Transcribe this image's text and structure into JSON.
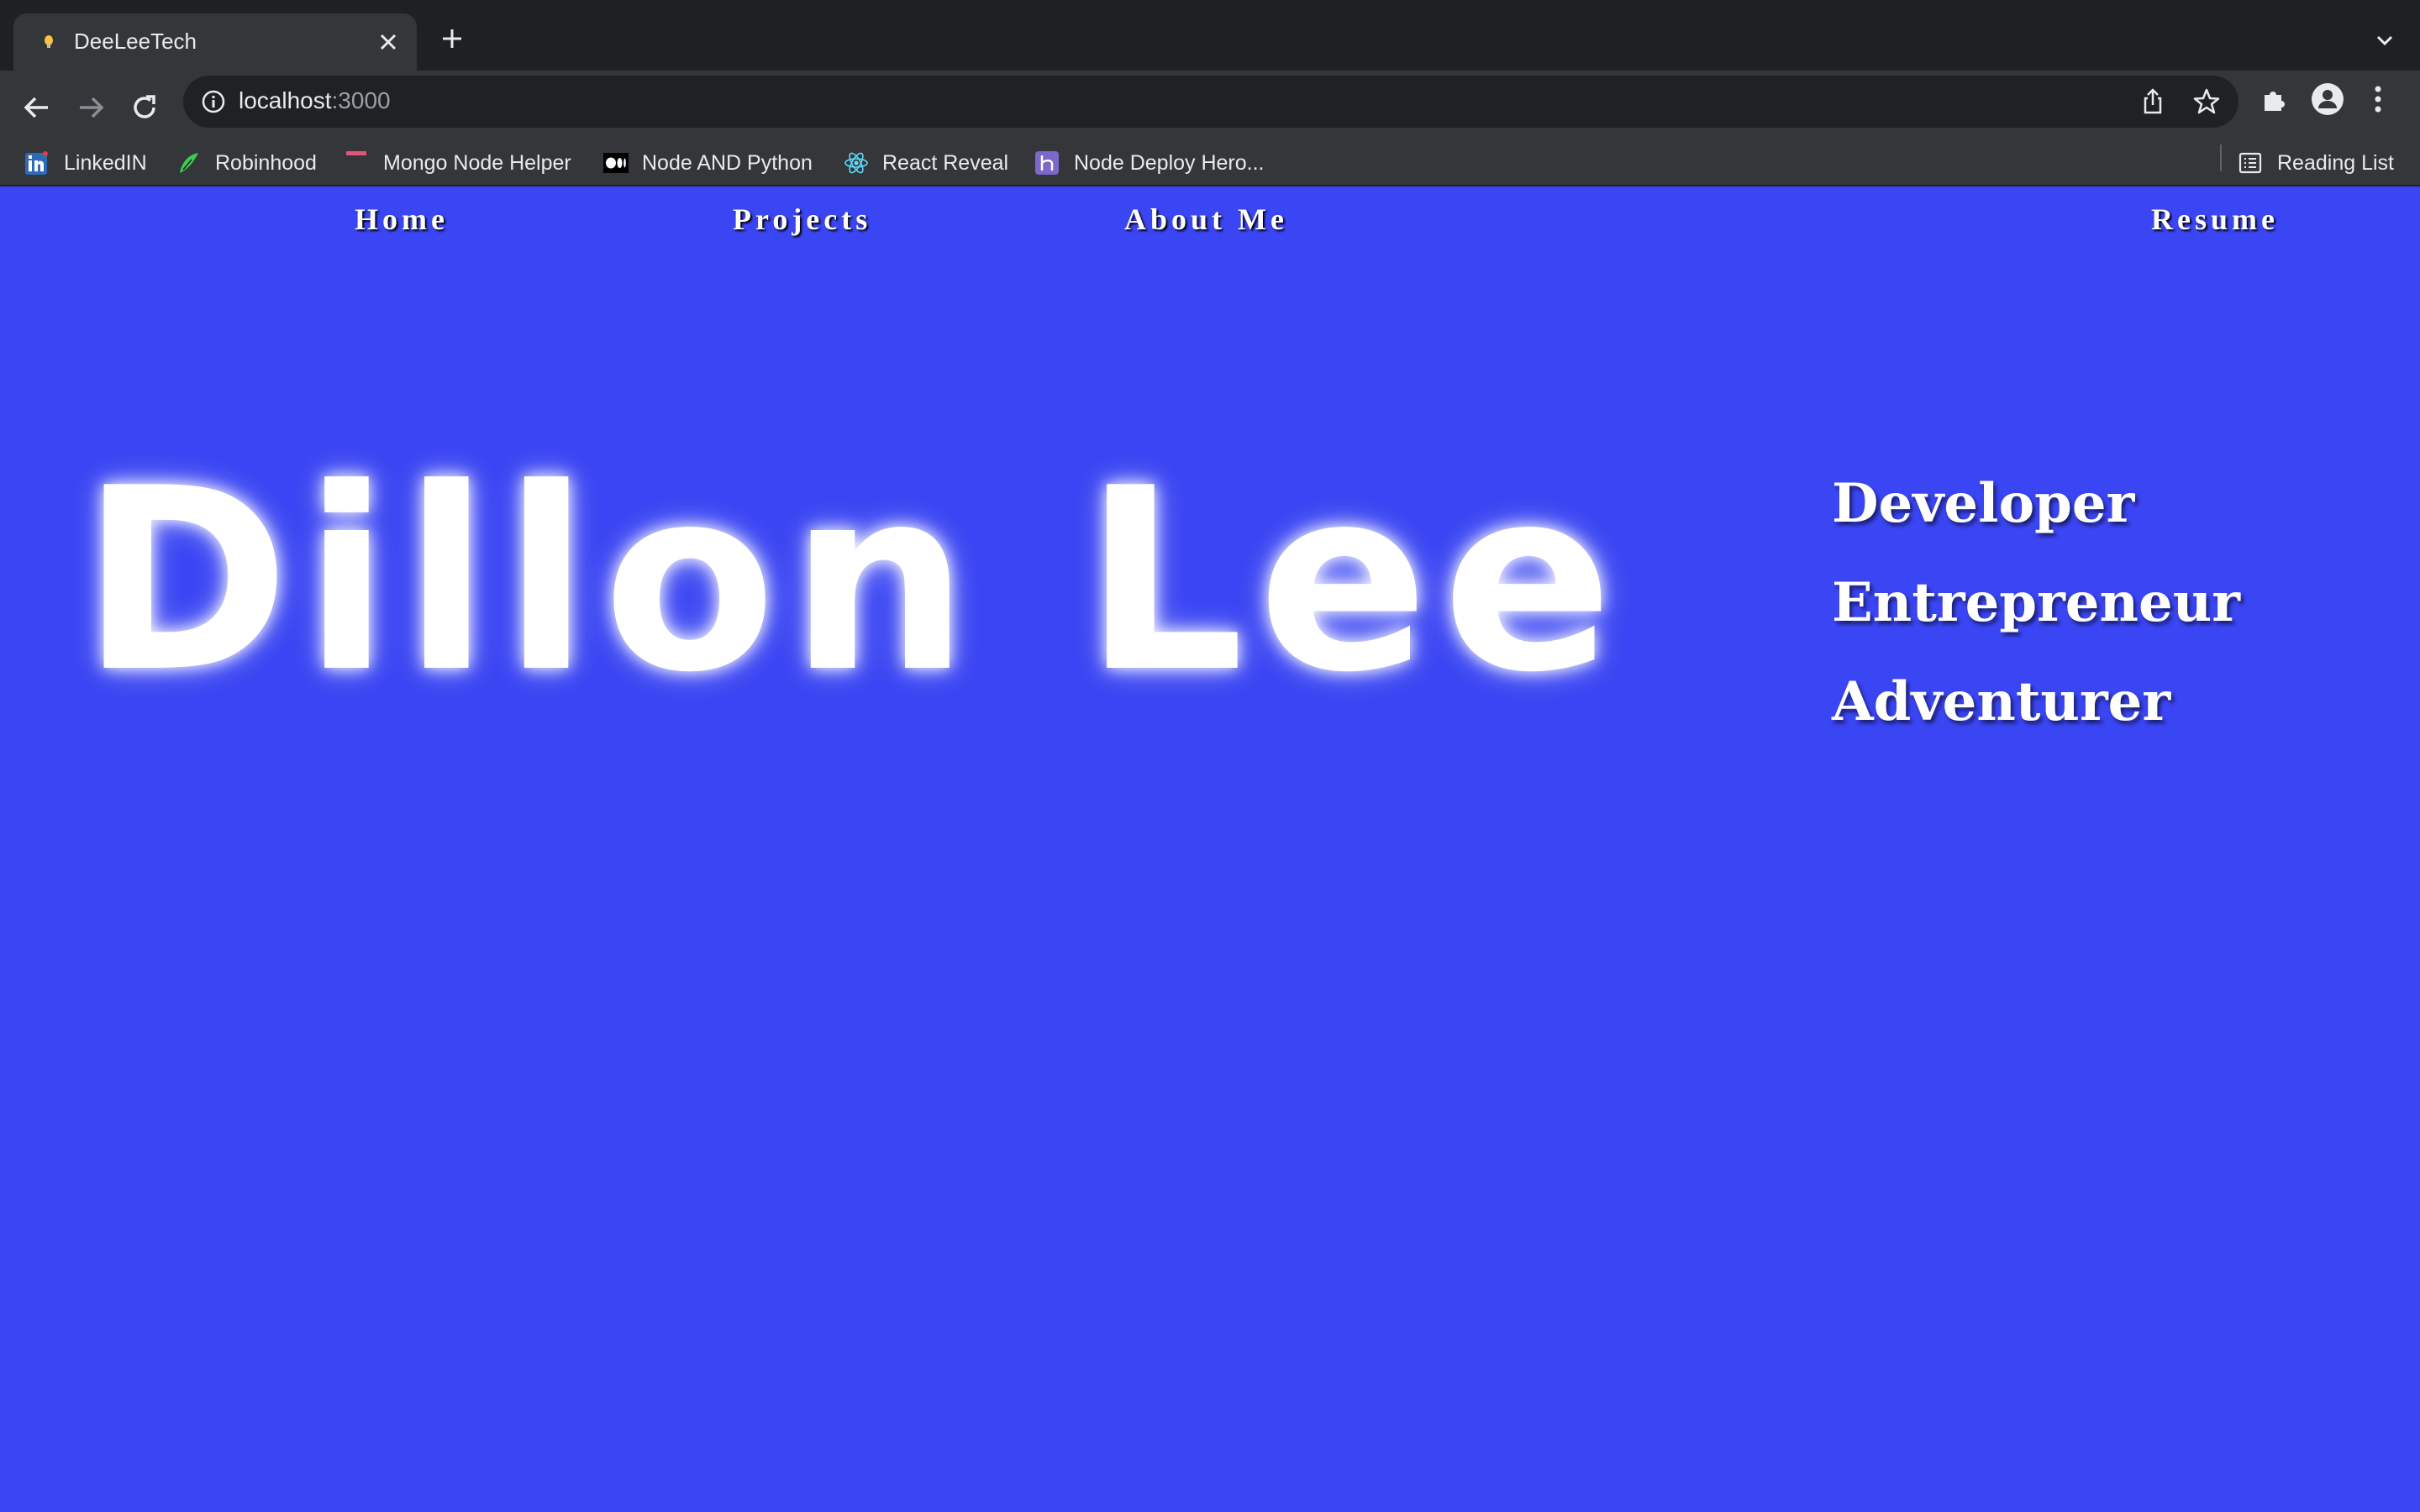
{
  "browser": {
    "tab": {
      "title": "DeeLeeTech"
    },
    "address": {
      "host": "localhost",
      "port": ":3000"
    },
    "bookmarks": [
      {
        "label": "LinkedIN",
        "icon": "linkedin-icon"
      },
      {
        "label": "Robinhood",
        "icon": "robinhood-icon"
      },
      {
        "label": "Mongo Node Helper",
        "icon": "mongo-icon"
      },
      {
        "label": "Node AND Python",
        "icon": "medium-icon"
      },
      {
        "label": "React Reveal",
        "icon": "react-icon"
      },
      {
        "label": "Node Deploy Hero...",
        "icon": "heroku-icon"
      }
    ],
    "reading_list": "Reading List"
  },
  "nav": {
    "home": "Home",
    "projects": "Projects",
    "about": "About Me",
    "resume": "Resume"
  },
  "hero": {
    "name": "Dillon Lee",
    "roles": [
      "Developer",
      "Entrepreneur",
      "Adventurer"
    ]
  },
  "colors": {
    "page_background": "#3a45f3",
    "text": "#ffffff",
    "chrome_dark": "#1f2023",
    "chrome_toolbar": "#35363a"
  }
}
